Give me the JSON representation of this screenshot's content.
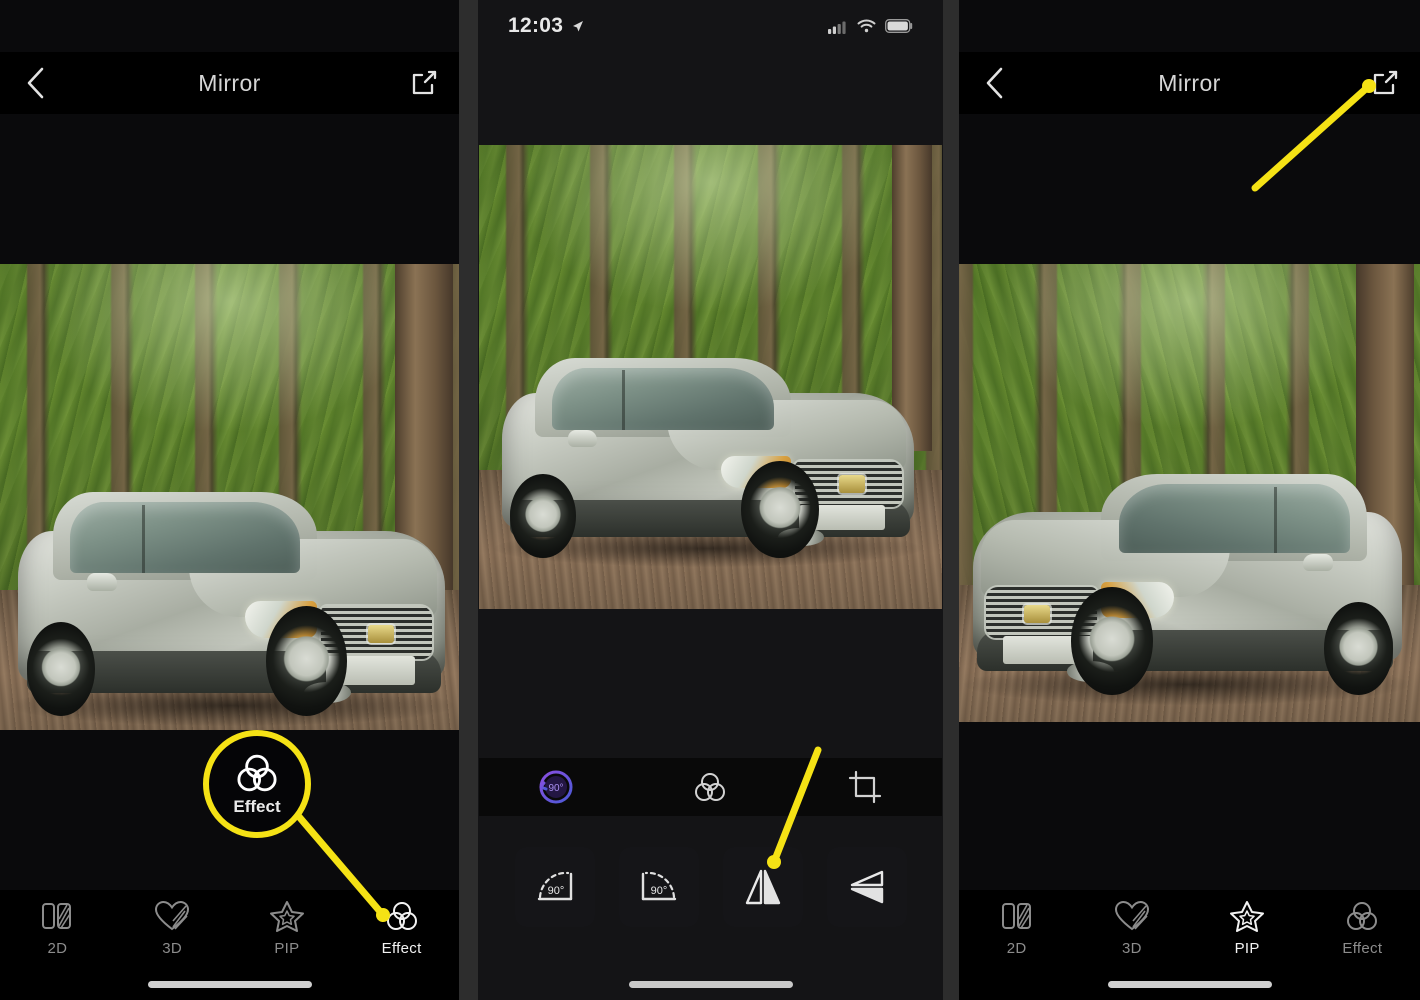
{
  "app": {
    "accent_yellow": "#f5e215",
    "active_purple": "#7b4ed8",
    "background": "#0a0a0c"
  },
  "panels": [
    {
      "id": "panel-1",
      "nav": {
        "back_icon": "chevron-left-icon",
        "title": "Mirror",
        "share_icon": "share-export-icon"
      },
      "photo": {
        "alt": "Silver Cadillac SRX SUV parked on a gravel path in a green forest",
        "flipped": false
      },
      "tabs": [
        {
          "label": "2D",
          "icon": "two-panel-icon",
          "active": false
        },
        {
          "label": "3D",
          "icon": "heart-icon",
          "active": false
        },
        {
          "label": "PIP",
          "icon": "star-icon",
          "active": false
        },
        {
          "label": "Effect",
          "icon": "three-circles-icon",
          "active": true
        }
      ],
      "callout": {
        "label": "Effect",
        "icon": "three-circles-icon"
      }
    },
    {
      "id": "panel-2",
      "status": {
        "time": "12:03",
        "location_icon": "location-arrow-icon",
        "signal_icon": "cellular-signal-icon",
        "wifi_icon": "wifi-icon",
        "battery_icon": "battery-full-icon"
      },
      "photo": {
        "alt": "Silver Cadillac SRX SUV parked on a gravel path in a green forest",
        "flipped": false
      },
      "edit_tabs": [
        {
          "icon": "rotate-90-icon",
          "name": "rotate",
          "active": true
        },
        {
          "icon": "three-circles-icon",
          "name": "effect",
          "active": false
        },
        {
          "icon": "crop-icon",
          "name": "crop",
          "active": false
        }
      ],
      "tools": [
        {
          "icon": "rotate-left-90-icon",
          "name": "rotate-left",
          "label": "90°"
        },
        {
          "icon": "rotate-right-90-icon",
          "name": "rotate-right",
          "label": "90°"
        },
        {
          "icon": "mirror-horizontal-icon",
          "name": "mirror-horizontal",
          "label": ""
        },
        {
          "icon": "flip-vertical-icon",
          "name": "flip-vertical",
          "label": ""
        }
      ],
      "callout": {
        "label": "",
        "icon": "mirror-horizontal-icon"
      }
    },
    {
      "id": "panel-3",
      "nav": {
        "back_icon": "chevron-left-icon",
        "title": "Mirror",
        "share_icon": "share-export-icon"
      },
      "photo": {
        "alt": "Mirrored silver Cadillac SRX SUV on a gravel path in a green forest",
        "flipped": true
      },
      "tabs": [
        {
          "label": "2D",
          "icon": "two-panel-icon",
          "active": false
        },
        {
          "label": "3D",
          "icon": "heart-icon",
          "active": false
        },
        {
          "label": "PIP",
          "icon": "star-icon",
          "active": true
        },
        {
          "label": "Effect",
          "icon": "three-circles-icon",
          "active": false
        }
      ],
      "callout": {
        "label": "",
        "icon": "share-export-icon"
      }
    }
  ]
}
